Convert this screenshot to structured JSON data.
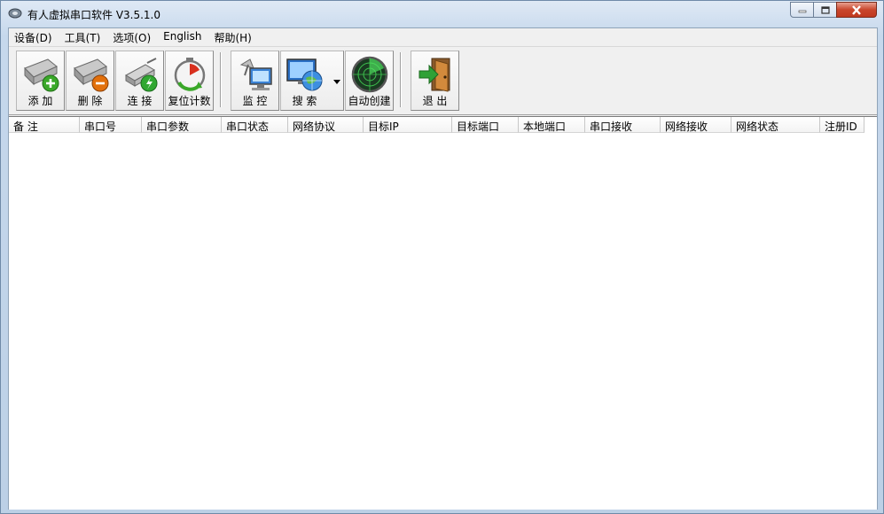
{
  "window": {
    "title": "有人虚拟串口软件 V3.5.1.0"
  },
  "menubar": {
    "items": [
      {
        "label": "设备(D)"
      },
      {
        "label": "工具(T)"
      },
      {
        "label": "选项(O)"
      },
      {
        "label": "English"
      },
      {
        "label": "帮助(H)"
      }
    ]
  },
  "toolbar": {
    "add": {
      "label": "添 加",
      "icon": "add-port-icon"
    },
    "delete": {
      "label": "删 除",
      "icon": "delete-port-icon"
    },
    "connect": {
      "label": "连 接",
      "icon": "connect-icon"
    },
    "reset_count": {
      "label": "复位计数",
      "icon": "stopwatch-icon"
    },
    "monitor": {
      "label": "监 控",
      "icon": "monitor-icon"
    },
    "search": {
      "label": "搜 索",
      "icon": "globe-search-icon"
    },
    "auto_create": {
      "label": "自动创建",
      "icon": "radar-icon"
    },
    "exit": {
      "label": "退 出",
      "icon": "exit-door-icon"
    }
  },
  "table": {
    "columns": [
      "备 注",
      "串口号",
      "串口参数",
      "串口状态",
      "网络协议",
      "目标IP",
      "目标端口",
      "本地端口",
      "串口接收",
      "网络接收",
      "网络状态",
      "注册ID"
    ],
    "rows": []
  },
  "colors": {
    "close_button": "#c9462c",
    "add_badge": "#3aa829",
    "delete_badge": "#e2700c",
    "connect_badge": "#31a832",
    "exit_arrow": "#2fa136"
  }
}
